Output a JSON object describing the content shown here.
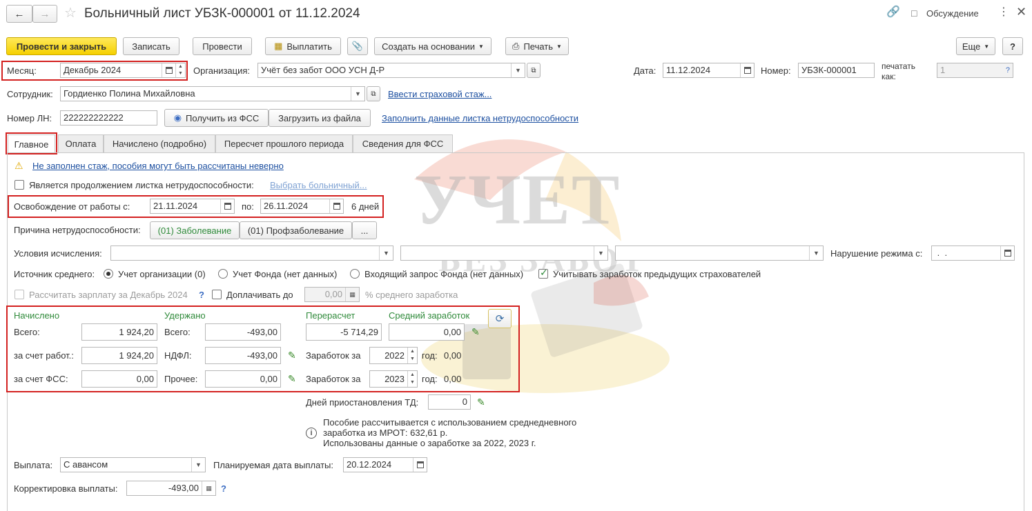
{
  "window": {
    "title": "Больничный лист УБЗК-000001 от 11.12.2024",
    "discussion": "Обсуждение"
  },
  "toolbar": {
    "post_close": "Провести и закрыть",
    "save": "Записать",
    "post": "Провести",
    "pay": "Выплатить",
    "create_based": "Создать на основании",
    "print": "Печать",
    "more": "Еще",
    "help": "?"
  },
  "header": {
    "month_label": "Месяц:",
    "month_value": "Декабрь 2024",
    "org_label": "Организация:",
    "org_value": "Учёт без забот ООО УСН Д-Р",
    "date_label": "Дата:",
    "date_value": "11.12.2024",
    "number_label": "Номер:",
    "number_value": "УБЗК-000001",
    "print_as_label_1": "печатать",
    "print_as_label_2": "как:",
    "print_as_value": "1",
    "employee_label": "Сотрудник:",
    "employee_value": "Гордиенко Полина Михайловна",
    "insurance_link": "Ввести страховой стаж...",
    "ln_label": "Номер ЛН:",
    "ln_value": "222222222222",
    "get_fss": "Получить из ФСС",
    "load_file": "Загрузить из файла",
    "fill_link": "Заполнить данные листка нетрудоспособности"
  },
  "tabs": [
    {
      "label": "Главное"
    },
    {
      "label": "Оплата"
    },
    {
      "label": "Начислено (подробно)"
    },
    {
      "label": "Пересчет прошлого периода"
    },
    {
      "label": "Сведения для ФСС"
    }
  ],
  "main": {
    "warning_link": "Не заполнен стаж, пособия могут быть рассчитаны неверно",
    "continuation_label": "Является продолжением листка нетрудоспособности:",
    "choose_sick_link": "Выбрать больничный...",
    "release_label": "Освобождение от работы с:",
    "release_from": "21.11.2024",
    "release_to_label": "по:",
    "release_to": "26.11.2024",
    "days": "6 дней",
    "reason_label": "Причина нетрудоспособности:",
    "reason_1": "(01) Заболевание",
    "reason_2": "(01) Профзаболевание",
    "reason_more": "...",
    "conditions_label": "Условия исчисления:",
    "violation_label": "Нарушение режима с:",
    "violation_value": " .  .",
    "avg_source_label": "Источник среднего:",
    "avg_opt1": "Учет организации (0)",
    "avg_opt2": "Учет Фонда (нет данных)",
    "avg_opt3": "Входящий запрос Фонда (нет данных)",
    "prev_insurers": "Учитывать заработок предыдущих страхователей",
    "calc_salary": "Рассчитать зарплату за Декабрь 2024",
    "calc_help": "?",
    "pay_up_to": "Доплачивать до",
    "pay_up_value": "0,00",
    "pct_avg": "% среднего заработка"
  },
  "totals": {
    "accrued_head": "Начислено",
    "withheld_head": "Удержано",
    "recalc_head": "Перерасчет",
    "avg_head": "Средний заработок",
    "total_label": "Всего:",
    "accrued_total": "1 924,20",
    "withheld_total_label": "Всего:",
    "withheld_total": "-493,00",
    "recalc_total": "-5 714,29",
    "avg_total": "0,00",
    "employer_label": "за счет работ.:",
    "employer_value": "1 924,20",
    "ndfl_label": "НДФЛ:",
    "ndfl_value": "-493,00",
    "earn1_label": "Заработок за",
    "earn1_year": "2022",
    "earn1_year_label": "год:",
    "earn1_value": "0,00",
    "fss_label": "за счет ФСС:",
    "fss_value": "0,00",
    "other_label": "Прочее:",
    "other_value": "0,00",
    "earn2_label": "Заработок за",
    "earn2_year": "2023",
    "earn2_year_label": "год:",
    "earn2_value": "0,00"
  },
  "bottom": {
    "suspend_label": "Дней приостановления ТД:",
    "suspend_value": "0",
    "info_1": "Пособие рассчитывается с использованием среднедневного",
    "info_2": "заработка из МРОТ: 632,61 р.",
    "info_3": "Использованы данные о заработке за  2022,  2023 г.",
    "payment_label": "Выплата:",
    "payment_value": "С авансом",
    "planned_label": "Планируемая дата выплаты:",
    "planned_value": "20.12.2024",
    "correction_label": "Корректировка выплаты:",
    "correction_value": "-493,00",
    "correction_help": "?"
  },
  "watermark": {
    "line1": "УЧЕТ",
    "line2": "БЕЗ ЗАБОТ"
  },
  "colors": {
    "accent_yellow": "#f5d000",
    "red_highlight": "#d3201f",
    "link_blue": "#1c4fa0",
    "green_heading": "#2f8a3a"
  }
}
